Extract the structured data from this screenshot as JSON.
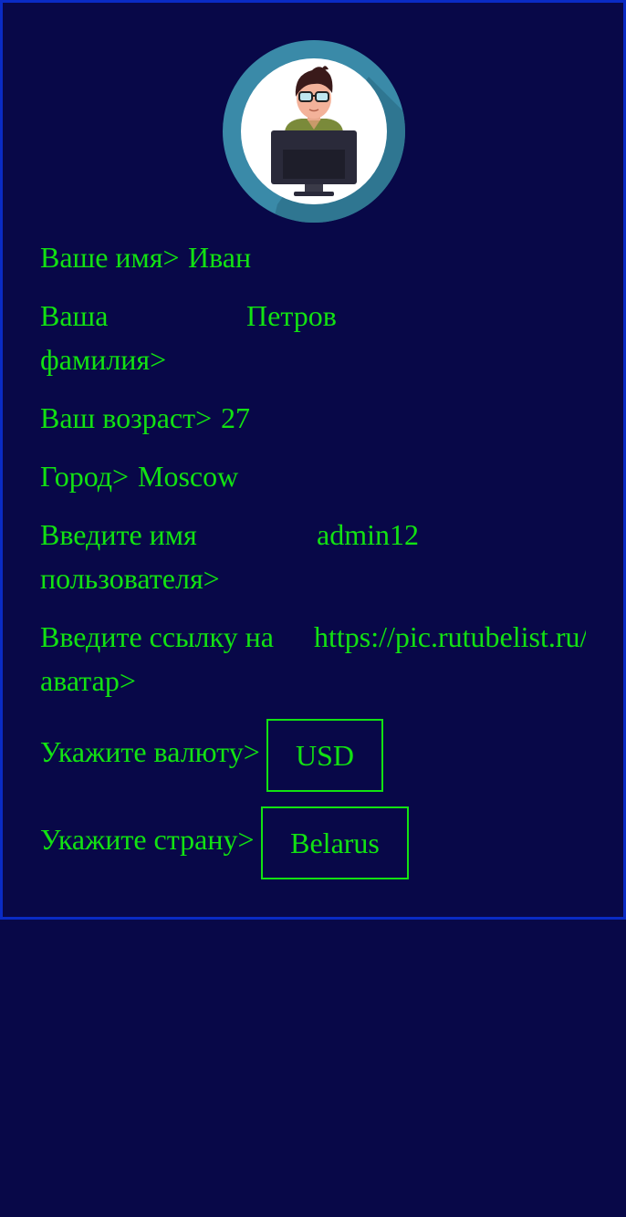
{
  "avatar": {
    "icon": "programmer-avatar-icon"
  },
  "fields": {
    "first_name": {
      "label": "Ваше имя>",
      "value": "Иван"
    },
    "last_name": {
      "label_line1": "Ваша",
      "label_line2": "фамилия>",
      "value": "Петров"
    },
    "age": {
      "label": "Ваш возраст>",
      "value": "27"
    },
    "city": {
      "label": "Город>",
      "value": "Moscow"
    },
    "username": {
      "label_line1": "Введите имя",
      "label_line2": "пользователя>",
      "value": "admin12"
    },
    "avatar_url": {
      "label_line1": "Введите ссылку на",
      "label_line2": "аватар>",
      "value": "https://pic.rutubelist.ru/"
    },
    "currency": {
      "label": "Укажите валюту>",
      "value": "USD"
    },
    "country": {
      "label": "Укажите страну>",
      "value": "Belarus"
    }
  },
  "colors": {
    "background": "#080848",
    "border": "#0a2bc4",
    "text": "#12e212"
  }
}
